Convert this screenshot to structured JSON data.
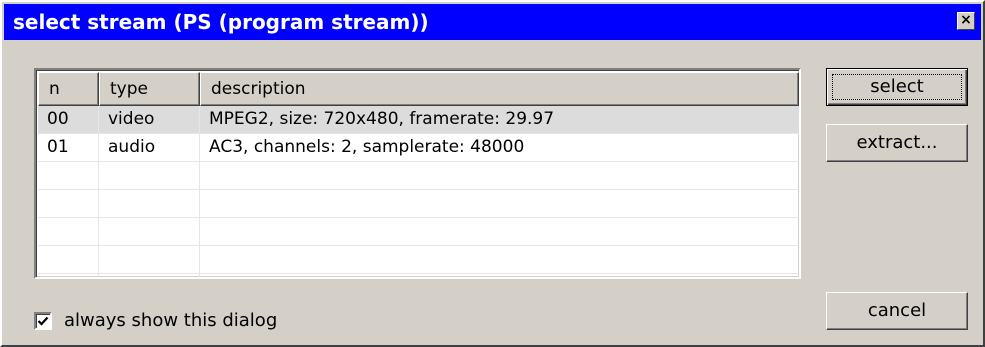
{
  "window": {
    "title": "select stream (PS (program stream))",
    "close_glyph": "×"
  },
  "list": {
    "columns": [
      "n",
      "type",
      "description"
    ],
    "rows": [
      {
        "n": "00",
        "type": "video",
        "description": "MPEG2, size: 720x480, framerate: 29.97",
        "selected": true
      },
      {
        "n": "01",
        "type": "audio",
        "description": "AC3, channels: 2, samplerate: 48000",
        "selected": false
      }
    ],
    "empty_rows": 5
  },
  "buttons": {
    "select_label": "select",
    "extract_label": "extract...",
    "cancel_label": "cancel"
  },
  "options": {
    "always_show_label": "always show this dialog",
    "always_show_checked": true
  },
  "colors": {
    "titlebar": "#0000ff",
    "dialog_face": "#d4d0c8",
    "selected_row": "#dcdcdc"
  }
}
